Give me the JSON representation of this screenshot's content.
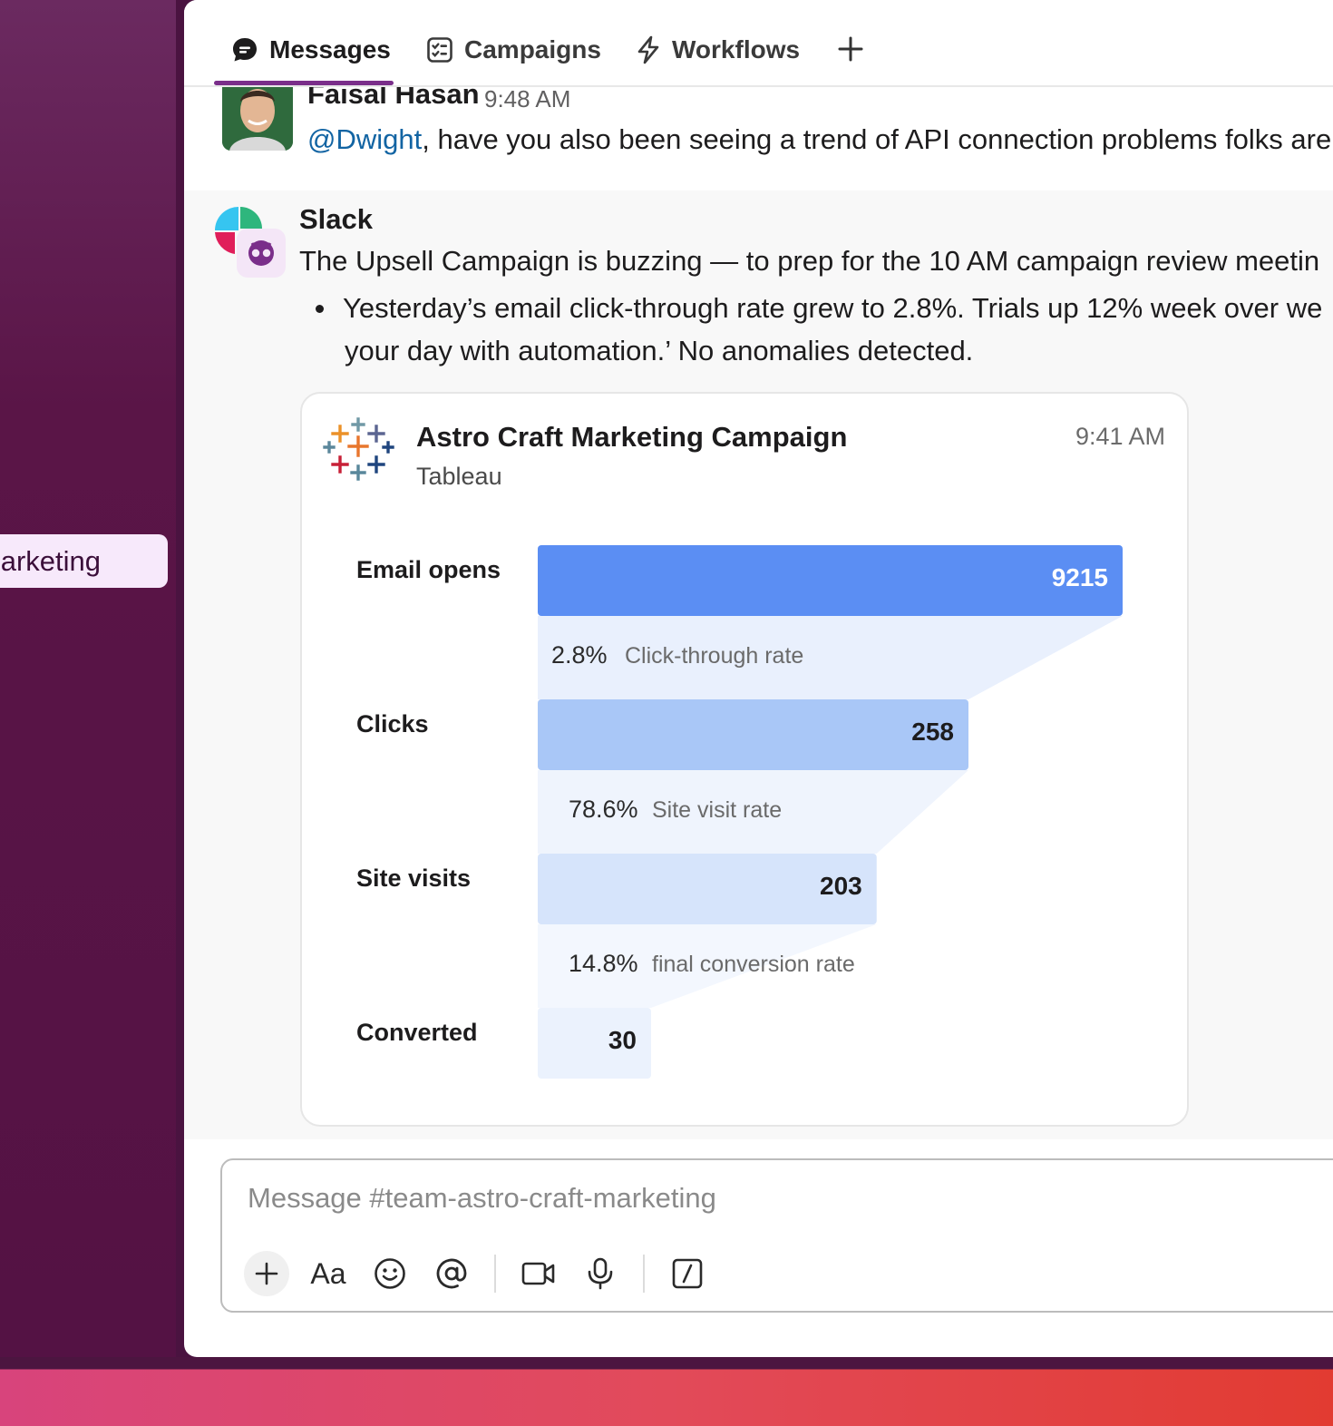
{
  "sidebar": {
    "active_item_label": "arketing"
  },
  "tabs": [
    {
      "label": "Messages",
      "icon": "chat-bubble-icon",
      "active": true
    },
    {
      "label": "Campaigns",
      "icon": "checklist-icon",
      "active": false
    },
    {
      "label": "Workflows",
      "icon": "lightning-icon",
      "active": false
    }
  ],
  "add_tab_icon": "plus-icon",
  "messages": [
    {
      "author": "Faisal Hasan",
      "time": "9:48 AM",
      "mention": "@Dwight",
      "text": ", have you also been seeing a trend of API connection problems folks are"
    },
    {
      "author": "Slack",
      "text": "The Upsell Campaign is buzzing — to prep for the 10 AM campaign review meetin",
      "bullet_line1": "Yesterday’s email click-through rate grew to 2.8%. Trials up 12% week over we",
      "bullet_line2": "your day with automation.’ No anomalies detected."
    }
  ],
  "card": {
    "title": "Astro Craft Marketing Campaign",
    "source": "Tableau",
    "time": "9:41 AM"
  },
  "chart_data": {
    "type": "bar",
    "categories": [
      "Email opens",
      "Clicks",
      "Site visits",
      "Converted"
    ],
    "values": [
      9215,
      258,
      203,
      30
    ],
    "rates": [
      {
        "pct": "2.8%",
        "label": "Click-through rate"
      },
      {
        "pct": "78.6%",
        "label": "Site visit rate"
      },
      {
        "pct": "14.8%",
        "label": "final conversion rate"
      }
    ],
    "bar_colors": [
      "#5b8ef3",
      "#a9c7f7",
      "#d6e4fb",
      "#ebf2fd"
    ],
    "connector_colors": [
      "#e9f0fd",
      "#eff4fd",
      "#f3f7fe"
    ],
    "value_colors": [
      "#ffffff",
      "#1d1c1d",
      "#1d1c1d",
      "#1d1c1d"
    ]
  },
  "composer": {
    "placeholder": "Message #team-astro-craft-marketing",
    "tools": [
      "plus-icon",
      "format-text-icon",
      "emoji-icon",
      "mention-icon",
      "video-icon",
      "microphone-icon",
      "slash-command-icon"
    ],
    "format_label": "Aa"
  }
}
